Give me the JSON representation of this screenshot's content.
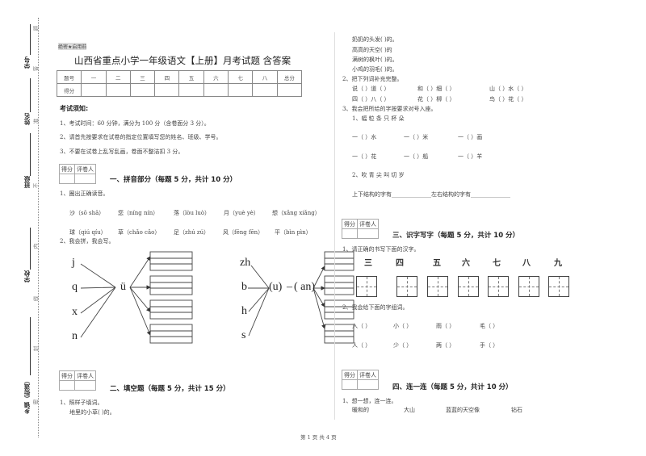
{
  "margin": {
    "labels": [
      "学号",
      "姓名",
      "班级",
      "学校",
      "乡镇（街道）"
    ],
    "seal_chars": [
      "题",
      "答",
      "准",
      "不",
      "内",
      "线",
      "封",
      "密"
    ]
  },
  "header": {
    "secret_label": "绝密★启用前",
    "title": "山西省重点小学一年级语文【上册】月考试题 含答案"
  },
  "score_table": {
    "row1": [
      "题号",
      "一",
      "二",
      "三",
      "四",
      "五",
      "六",
      "七",
      "八",
      "总分"
    ],
    "row2": [
      "得分",
      "",
      "",
      "",
      "",
      "",
      "",
      "",
      "",
      ""
    ]
  },
  "notice": {
    "heading": "考试须知:",
    "items": [
      "1、考试时间：60 分钟，满分为 100 分（含卷面分 3 分）。",
      "2、请首先按要求在试卷的指定位置填写您的姓名、班级、学号。",
      "3、不要在试卷上乱写乱画，卷面不整洁扣 3 分。"
    ]
  },
  "grader": {
    "score": "得分",
    "reviewer": "评卷人"
  },
  "section1": {
    "title": "一、拼音部分（每题 5 分，共计 10 分）",
    "q1": "1、圈出正确读音。",
    "row1": [
      "沙（sō shā）",
      "您（níng nín）",
      "落（lòu luò）",
      "月（yuè yè）",
      "想（xǎng  xiǎng）"
    ],
    "row2": [
      "球（qiú qíu）",
      "草（chǎo cǎo）",
      "足（zhú zú）",
      "风（fēng fēn）",
      "平（bìn pìn）"
    ],
    "q2": "2、我会拼，我会写。",
    "diagram_left": {
      "initials": [
        "j",
        "q",
        "x",
        "n"
      ],
      "final": "ü"
    },
    "diagram_right": {
      "initials": [
        "zh",
        "b",
        "h",
        "s"
      ],
      "medial": "(u)",
      "dash": "–",
      "final": "( an)"
    }
  },
  "section2": {
    "title": "二、填空题（每题 5 分，共计 15 分）",
    "q1": "1、照样子填词。",
    "fill_items": [
      "地里的小草(                    )的。",
      "奶奶的头发(                    )的。",
      "高高的天空(                    )的",
      "满树的枫叶(                    )的。",
      "小鸡的羽毛(                    )的。"
    ],
    "q2": "2、把下列词补充完整。",
    "q2_row1": [
      "说（  ）道（  ）",
      "和（  ）细（  ）",
      "山（  ）水（  ）"
    ],
    "q2_row2": [
      "四（  ）八（  ）",
      "花（  ）柳（  ）",
      "鸟（  ）花（  ）"
    ],
    "q3": "3、我会把所给的字按要求对号入座。",
    "q3_sub1": "1、幅  粒  条  只  杯  朵",
    "q3_row1": [
      "一（  ）水",
      "一（  ）米",
      "一（  ）画"
    ],
    "q3_row2": [
      "一（  ）花",
      "一（  ）船",
      "一（  ）羊"
    ],
    "q3_sub2": "2、吹   青   尖   叫   切   岁",
    "q3_struct": "上下结构的字有______________左右结构的字有______________"
  },
  "section3": {
    "title": "三、识字写字（每题 5 分，共计 10 分）",
    "q1": "1、请正确的书写下面的汉字。",
    "chars": [
      "三",
      "四",
      "五",
      "六",
      "七",
      "八",
      "九"
    ],
    "q2": "2、我会给下面的字组词。",
    "row1": [
      "入（        ）",
      "小（        ）",
      "雨（        ）",
      "毛（        ）"
    ],
    "row2": [
      "人（        ）",
      "少（        ）",
      "两（        ）",
      "手（        ）"
    ]
  },
  "section4": {
    "title": "四、连一连（每题 5 分，共计 10 分）",
    "q1": "1、想一想，连一连。",
    "words": [
      "暖和的",
      "大山",
      "蓝蓝的天空像",
      "钻石"
    ]
  },
  "footer": {
    "page": "第 1 页 共 4 页"
  }
}
